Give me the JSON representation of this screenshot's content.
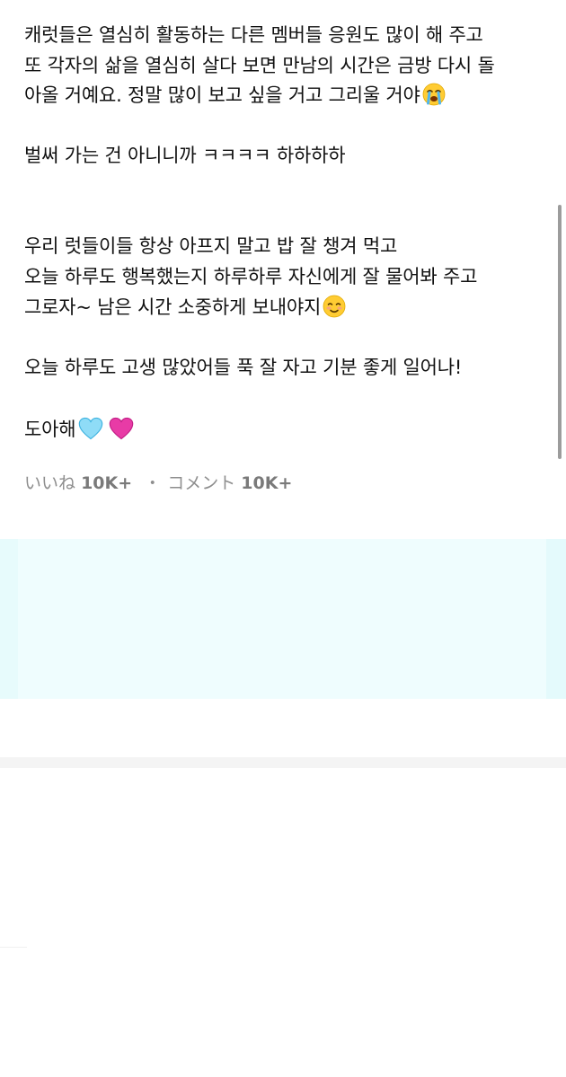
{
  "post": {
    "lines": [
      "캐럿들은 열심히 활동하는 다른 멤버들 응원도 많이 해 주고",
      "또 각자의 삶을 열심히 살다 보면 만남의 시간은 금방 다시 돌",
      "아올 거예요. 정말 많이 보고 싶을 거고 그리울 거야",
      "벌써 가는 건 아니니까 ㅋㅋㅋㅋ 하하하하",
      "우리 럿들이들 항상 아프지 말고 밥 잘 챙겨 먹고",
      "오늘 하루도 행복했는지 하루하루 자신에게 잘 물어봐 주고",
      "그로자~ 남은 시간 소중하게 보내야지",
      "오늘 하루도 고생 많았어들 푹 잘 자고 기분 좋게 일어나!",
      "도아해"
    ],
    "emojis": {
      "crying": "loudly-crying-face-emoji",
      "smiling": "smiling-face-emoji",
      "light_blue_heart": "light-blue-heart-emoji",
      "pink_heart": "growing-heart-emoji"
    }
  },
  "stats": {
    "likes_label": "いいね",
    "likes_count": "10K+",
    "separator": "・",
    "comments_label": "コメント",
    "comments_count": "10K+"
  },
  "colors": {
    "text": "#111111",
    "muted": "#8e8e8e",
    "hero_bg": "#effdfe",
    "scrollbar": "#9c9c9c"
  }
}
